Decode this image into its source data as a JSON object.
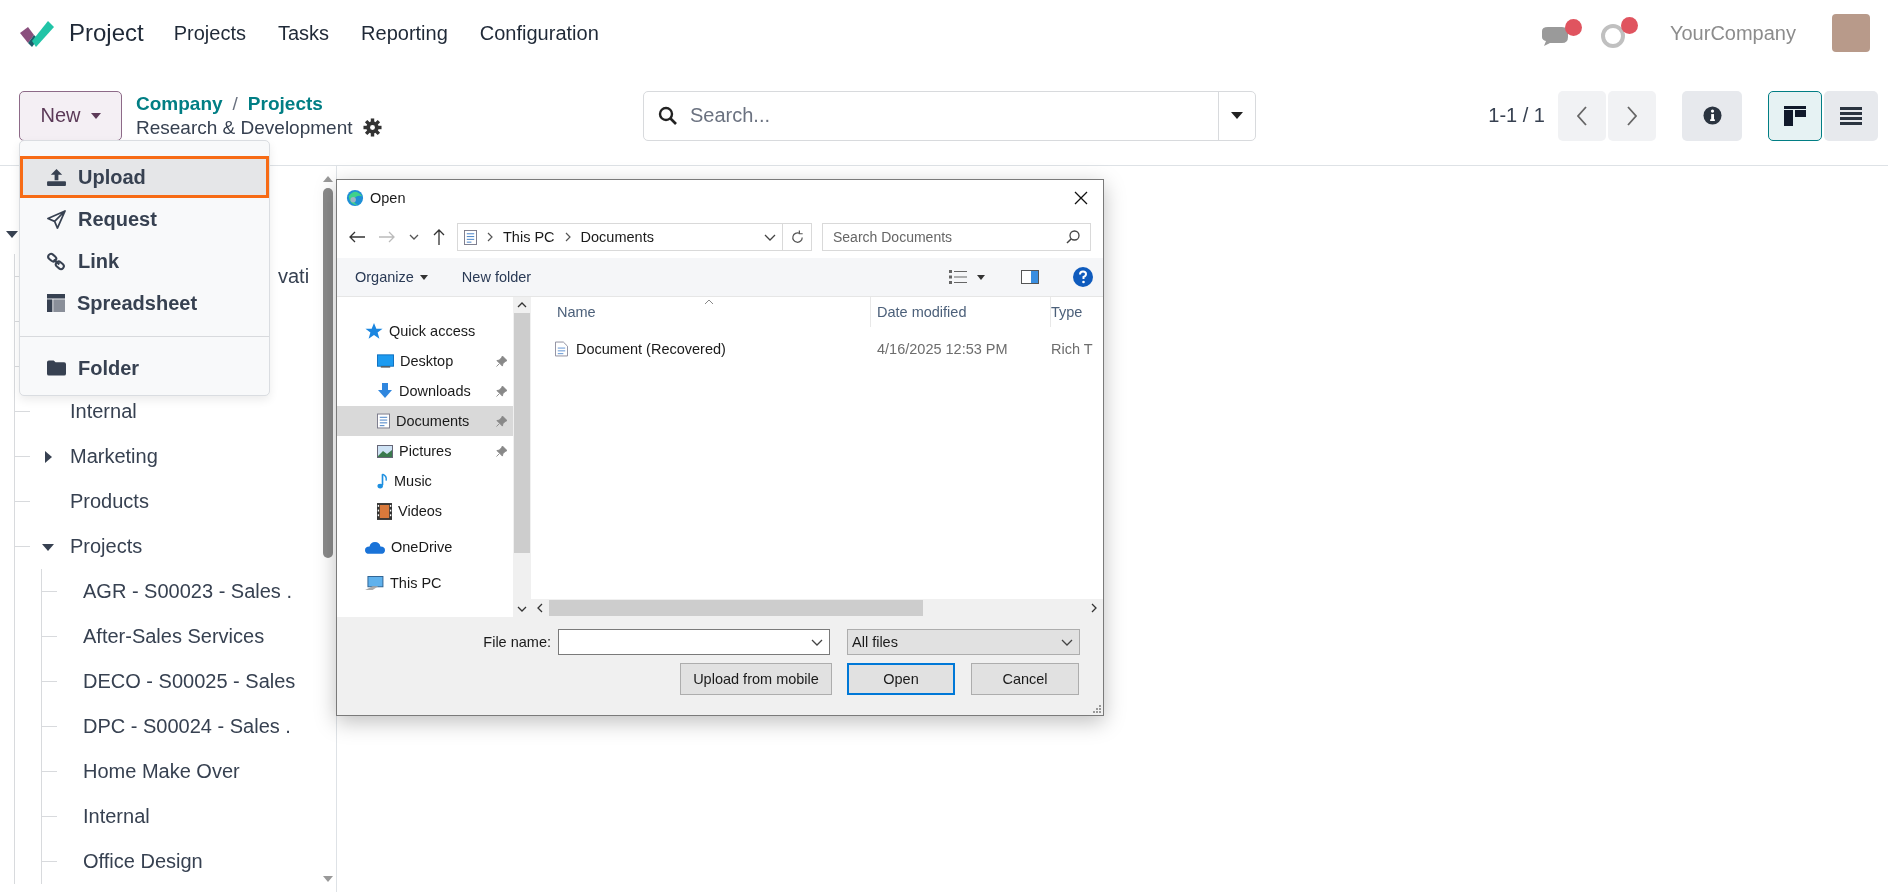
{
  "app": {
    "name": "Project"
  },
  "menu": [
    "Projects",
    "Tasks",
    "Reporting",
    "Configuration"
  ],
  "systray": {
    "company": "YourCompany"
  },
  "control_panel": {
    "new_button": "New",
    "breadcrumb": [
      "Company",
      "Projects"
    ],
    "separator": "/",
    "current": "Research & Development",
    "search": {
      "placeholder": "Search..."
    },
    "pager": "1-1 / 1",
    "views": [
      {
        "kind": "kanban",
        "selected": true
      },
      {
        "kind": "list",
        "selected": false
      }
    ]
  },
  "new_menu": {
    "sections": [
      [
        {
          "kind": "upload",
          "label": "Upload",
          "selected": true
        },
        {
          "kind": "request",
          "label": "Request",
          "selected": false
        },
        {
          "kind": "link",
          "label": "Link",
          "selected": false
        },
        {
          "kind": "spreadsheet",
          "label": "Spreadsheet",
          "selected": false
        }
      ],
      [
        {
          "kind": "folder",
          "label": "Folder",
          "selected": false
        }
      ]
    ]
  },
  "sidebar": {
    "root_expanded": true,
    "covered_label": "vati",
    "items": [
      {
        "label": "Internal"
      },
      {
        "label": "Marketing",
        "expanded": false
      },
      {
        "label": "Products"
      },
      {
        "label": "Projects",
        "expanded": true,
        "children": [
          {
            "label": "AGR - S00023 - Sales ."
          },
          {
            "label": "After-Sales Services"
          },
          {
            "label": "DECO - S00025 - Sales"
          },
          {
            "label": "DPC - S00024 - Sales ."
          },
          {
            "label": "Home Make Over"
          },
          {
            "label": "Internal"
          },
          {
            "label": "Office Design"
          }
        ]
      }
    ]
  },
  "dialog": {
    "title": "Open",
    "path": [
      "This PC",
      "Documents"
    ],
    "search": {
      "placeholder": "Search Documents"
    },
    "toolbar": [
      "Organize",
      "New folder"
    ],
    "nav": [
      {
        "kind": "star",
        "label": "Quick access",
        "pinned": false,
        "selected": false,
        "children": [
          {
            "kind": "desktop",
            "label": "Desktop",
            "pinned": true,
            "selected": false
          },
          {
            "kind": "downloads",
            "label": "Downloads",
            "pinned": true,
            "selected": false
          },
          {
            "kind": "documents",
            "label": "Documents",
            "pinned": true,
            "selected": true
          },
          {
            "kind": "pictures",
            "label": "Pictures",
            "pinned": true,
            "selected": false
          },
          {
            "kind": "music",
            "label": "Music",
            "pinned": false,
            "selected": false
          },
          {
            "kind": "videos",
            "label": "Videos",
            "pinned": false,
            "selected": false
          }
        ]
      },
      {
        "kind": "cloud",
        "label": "OneDrive",
        "pinned": false,
        "selected": false
      },
      {
        "kind": "pc",
        "label": "This PC",
        "pinned": false,
        "selected": false
      }
    ],
    "columns": [
      "Name",
      "Date modified",
      "Type"
    ],
    "files": [
      {
        "name": "Document (Recovered)",
        "date": "4/16/2025 12:53 PM",
        "type": "Rich T"
      }
    ],
    "file_name_label": "File name:",
    "file_type": "All files",
    "buttons": [
      {
        "label": "Upload from mobile",
        "default": false
      },
      {
        "label": "Open",
        "default": true
      },
      {
        "label": "Cancel",
        "default": false
      }
    ]
  }
}
